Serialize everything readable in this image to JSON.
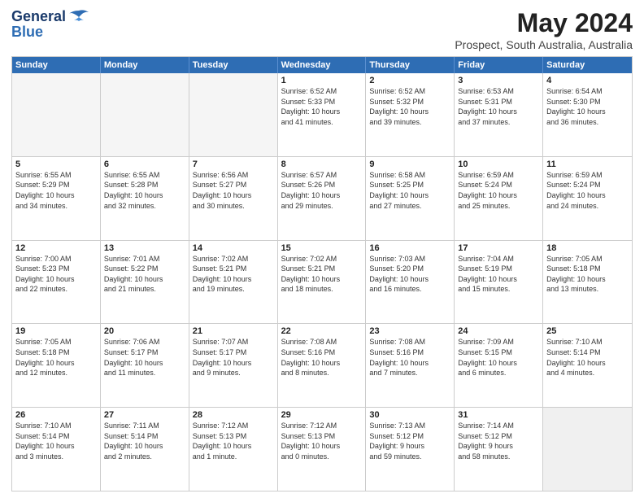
{
  "header": {
    "logo_line1": "General",
    "logo_line2": "Blue",
    "title": "May 2024",
    "subtitle": "Prospect, South Australia, Australia"
  },
  "weekdays": [
    "Sunday",
    "Monday",
    "Tuesday",
    "Wednesday",
    "Thursday",
    "Friday",
    "Saturday"
  ],
  "weeks": [
    [
      {
        "day": "",
        "info": "",
        "empty": true
      },
      {
        "day": "",
        "info": "",
        "empty": true
      },
      {
        "day": "",
        "info": "",
        "empty": true
      },
      {
        "day": "1",
        "info": "Sunrise: 6:52 AM\nSunset: 5:33 PM\nDaylight: 10 hours\nand 41 minutes.",
        "empty": false
      },
      {
        "day": "2",
        "info": "Sunrise: 6:52 AM\nSunset: 5:32 PM\nDaylight: 10 hours\nand 39 minutes.",
        "empty": false
      },
      {
        "day": "3",
        "info": "Sunrise: 6:53 AM\nSunset: 5:31 PM\nDaylight: 10 hours\nand 37 minutes.",
        "empty": false
      },
      {
        "day": "4",
        "info": "Sunrise: 6:54 AM\nSunset: 5:30 PM\nDaylight: 10 hours\nand 36 minutes.",
        "empty": false
      }
    ],
    [
      {
        "day": "5",
        "info": "Sunrise: 6:55 AM\nSunset: 5:29 PM\nDaylight: 10 hours\nand 34 minutes.",
        "empty": false
      },
      {
        "day": "6",
        "info": "Sunrise: 6:55 AM\nSunset: 5:28 PM\nDaylight: 10 hours\nand 32 minutes.",
        "empty": false
      },
      {
        "day": "7",
        "info": "Sunrise: 6:56 AM\nSunset: 5:27 PM\nDaylight: 10 hours\nand 30 minutes.",
        "empty": false
      },
      {
        "day": "8",
        "info": "Sunrise: 6:57 AM\nSunset: 5:26 PM\nDaylight: 10 hours\nand 29 minutes.",
        "empty": false
      },
      {
        "day": "9",
        "info": "Sunrise: 6:58 AM\nSunset: 5:25 PM\nDaylight: 10 hours\nand 27 minutes.",
        "empty": false
      },
      {
        "day": "10",
        "info": "Sunrise: 6:59 AM\nSunset: 5:24 PM\nDaylight: 10 hours\nand 25 minutes.",
        "empty": false
      },
      {
        "day": "11",
        "info": "Sunrise: 6:59 AM\nSunset: 5:24 PM\nDaylight: 10 hours\nand 24 minutes.",
        "empty": false
      }
    ],
    [
      {
        "day": "12",
        "info": "Sunrise: 7:00 AM\nSunset: 5:23 PM\nDaylight: 10 hours\nand 22 minutes.",
        "empty": false
      },
      {
        "day": "13",
        "info": "Sunrise: 7:01 AM\nSunset: 5:22 PM\nDaylight: 10 hours\nand 21 minutes.",
        "empty": false
      },
      {
        "day": "14",
        "info": "Sunrise: 7:02 AM\nSunset: 5:21 PM\nDaylight: 10 hours\nand 19 minutes.",
        "empty": false
      },
      {
        "day": "15",
        "info": "Sunrise: 7:02 AM\nSunset: 5:21 PM\nDaylight: 10 hours\nand 18 minutes.",
        "empty": false
      },
      {
        "day": "16",
        "info": "Sunrise: 7:03 AM\nSunset: 5:20 PM\nDaylight: 10 hours\nand 16 minutes.",
        "empty": false
      },
      {
        "day": "17",
        "info": "Sunrise: 7:04 AM\nSunset: 5:19 PM\nDaylight: 10 hours\nand 15 minutes.",
        "empty": false
      },
      {
        "day": "18",
        "info": "Sunrise: 7:05 AM\nSunset: 5:18 PM\nDaylight: 10 hours\nand 13 minutes.",
        "empty": false
      }
    ],
    [
      {
        "day": "19",
        "info": "Sunrise: 7:05 AM\nSunset: 5:18 PM\nDaylight: 10 hours\nand 12 minutes.",
        "empty": false
      },
      {
        "day": "20",
        "info": "Sunrise: 7:06 AM\nSunset: 5:17 PM\nDaylight: 10 hours\nand 11 minutes.",
        "empty": false
      },
      {
        "day": "21",
        "info": "Sunrise: 7:07 AM\nSunset: 5:17 PM\nDaylight: 10 hours\nand 9 minutes.",
        "empty": false
      },
      {
        "day": "22",
        "info": "Sunrise: 7:08 AM\nSunset: 5:16 PM\nDaylight: 10 hours\nand 8 minutes.",
        "empty": false
      },
      {
        "day": "23",
        "info": "Sunrise: 7:08 AM\nSunset: 5:16 PM\nDaylight: 10 hours\nand 7 minutes.",
        "empty": false
      },
      {
        "day": "24",
        "info": "Sunrise: 7:09 AM\nSunset: 5:15 PM\nDaylight: 10 hours\nand 6 minutes.",
        "empty": false
      },
      {
        "day": "25",
        "info": "Sunrise: 7:10 AM\nSunset: 5:14 PM\nDaylight: 10 hours\nand 4 minutes.",
        "empty": false
      }
    ],
    [
      {
        "day": "26",
        "info": "Sunrise: 7:10 AM\nSunset: 5:14 PM\nDaylight: 10 hours\nand 3 minutes.",
        "empty": false
      },
      {
        "day": "27",
        "info": "Sunrise: 7:11 AM\nSunset: 5:14 PM\nDaylight: 10 hours\nand 2 minutes.",
        "empty": false
      },
      {
        "day": "28",
        "info": "Sunrise: 7:12 AM\nSunset: 5:13 PM\nDaylight: 10 hours\nand 1 minute.",
        "empty": false
      },
      {
        "day": "29",
        "info": "Sunrise: 7:12 AM\nSunset: 5:13 PM\nDaylight: 10 hours\nand 0 minutes.",
        "empty": false
      },
      {
        "day": "30",
        "info": "Sunrise: 7:13 AM\nSunset: 5:12 PM\nDaylight: 9 hours\nand 59 minutes.",
        "empty": false
      },
      {
        "day": "31",
        "info": "Sunrise: 7:14 AM\nSunset: 5:12 PM\nDaylight: 9 hours\nand 58 minutes.",
        "empty": false
      },
      {
        "day": "",
        "info": "",
        "empty": true,
        "shaded": true
      }
    ]
  ]
}
